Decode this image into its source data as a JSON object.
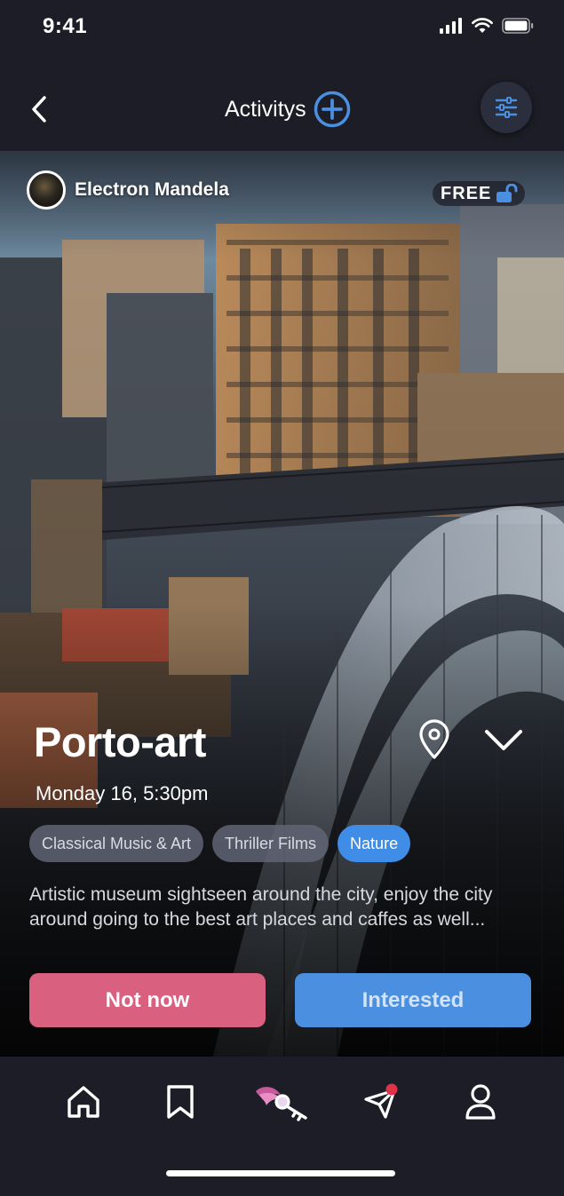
{
  "status_bar": {
    "time": "9:41"
  },
  "header": {
    "title": "Activitys"
  },
  "event": {
    "host_name": "Electron Mandela",
    "price_badge": "FREE",
    "title": "Porto-art",
    "date": "Monday 16, 5:30pm",
    "tags": [
      {
        "label": "Classical Music & Art",
        "active": false
      },
      {
        "label": "Thriller Films",
        "active": false
      },
      {
        "label": "Nature",
        "active": true
      }
    ],
    "description": "Artistic museum sightseen around the city, enjoy the city around going to the best art places and caffes as well...",
    "not_now_label": "Not now",
    "interested_label": "Interested"
  },
  "bottom_nav": {
    "items": [
      "home-icon",
      "bookmark-icon",
      "brand-key-icon",
      "send-icon",
      "profile-icon"
    ]
  },
  "colors": {
    "background": "#1c1d26",
    "accent_blue": "#4a8fe0",
    "not_now_pink": "#d9607f",
    "notification_red": "#e0334a"
  }
}
